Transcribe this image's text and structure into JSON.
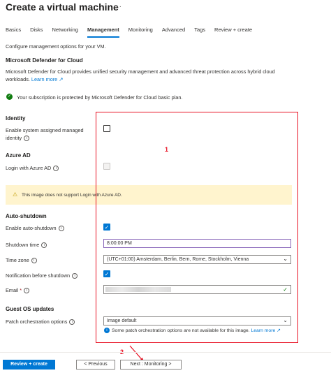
{
  "header": {
    "title": "Create a virtual machine",
    "more": "···"
  },
  "tabs": [
    {
      "label": "Basics"
    },
    {
      "label": "Disks"
    },
    {
      "label": "Networking"
    },
    {
      "label": "Management"
    },
    {
      "label": "Monitoring"
    },
    {
      "label": "Advanced"
    },
    {
      "label": "Tags"
    },
    {
      "label": "Review + create"
    }
  ],
  "intro": "Configure management options for your VM.",
  "defender": {
    "heading": "Microsoft Defender for Cloud",
    "description": "Microsoft Defender for Cloud provides unified security management and advanced threat protection across hybrid cloud",
    "description2": "workloads.",
    "learn_more": "Learn more",
    "status": "Your subscription is protected by Microsoft Defender for Cloud basic plan."
  },
  "identity": {
    "heading": "Identity",
    "label_line1": "Enable system assigned managed",
    "label_line2": "identity"
  },
  "azure_ad": {
    "heading": "Azure AD",
    "label": "Login with Azure AD",
    "warning": "This image does not support Login with Azure AD."
  },
  "auto_shutdown": {
    "heading": "Auto-shutdown",
    "enable_label": "Enable auto-shutdown",
    "time_label": "Shutdown time",
    "time_value": "8:00:00 PM",
    "tz_label": "Time zone",
    "tz_value": "(UTC+01:00) Amsterdam, Berlin, Bern, Rome, Stockholm, Vienna",
    "notify_label": "Notification before shutdown",
    "email_label": "Email",
    "required_mark": "*",
    "email_value": ""
  },
  "guest_os": {
    "heading": "Guest OS updates",
    "patch_label": "Patch orchestration options",
    "patch_value": "Image default",
    "patch_note": "Some patch orchestration options are not available for this image.",
    "learn_more": "Learn more"
  },
  "annotations": {
    "box_number": "1",
    "arrow_number": "2"
  },
  "footer": {
    "review_create": "Review + create",
    "previous": "< Previous",
    "next": "Next : Monitoring >"
  },
  "colors": {
    "accent": "#0078d4",
    "annotation": "#e81123",
    "success": "#107c10",
    "warning": "#c19c00"
  }
}
